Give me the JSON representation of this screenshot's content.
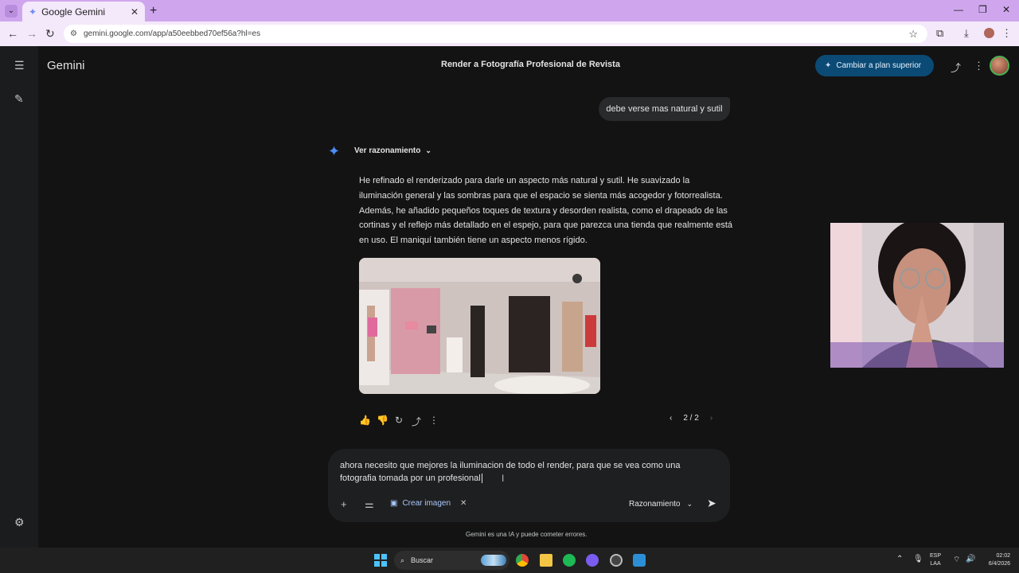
{
  "browser": {
    "tab_title": "Google Gemini",
    "url": "gemini.google.com/app/a50eebbed70ef56a?hl=es"
  },
  "app": {
    "brand": "Gemini",
    "conversation_title": "Render a Fotografía Profesional de Revista",
    "upgrade_label": "Cambiar a plan superior",
    "accent_color": "#4f8df7"
  },
  "chat": {
    "user_message": "debe verse mas natural y sutil",
    "reasoning_toggle": "Ver razonamiento",
    "answer_paragraphs": [
      "He refinado el renderizado para darle un aspecto más natural y sutil. He suavizado la iluminación general y las sombras para que el espacio se sienta más acogedor y fotorrealista. Además, he añadido pequeños toques de textura y desorden realista, como el drapeado de las cortinas y el reflejo más detallado en el espejo, para que parezca una tienda que realmente está en uso. El maniquí también tiene un aspecto menos rígido."
    ],
    "pager": "2 / 2"
  },
  "composer": {
    "text": "ahora necesito que mejores la iluminacion de todo el render, para que se vea como una fotografia tomada por un profesional",
    "create_image_label": "Crear imagen",
    "mode_label": "Razonamiento",
    "disclaimer": "Gemini es una IA y puede cometer errores."
  },
  "taskbar": {
    "search_label": "Buscar",
    "lang_top": "ESP",
    "lang_bottom": "LAA",
    "time": "02:02",
    "date": "6/4/2026"
  }
}
